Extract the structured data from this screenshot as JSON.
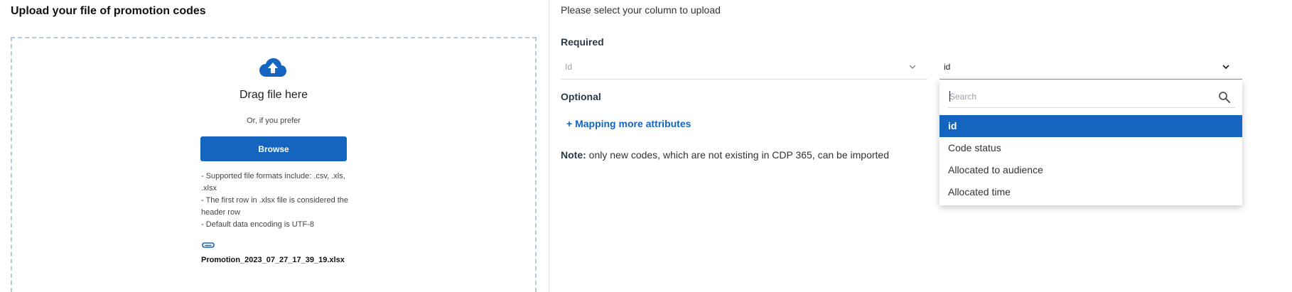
{
  "upload": {
    "title": "Upload your file of promotion codes",
    "drag_text": "Drag file here",
    "prefer_text": "Or, if you prefer",
    "browse_label": "Browse",
    "hints": [
      "- Supported file formats include: .csv, .xls, .xlsx",
      "- The first row in .xlsx file is considered the header row",
      "- Default data encoding is UTF-8"
    ],
    "file_name": "Promotion_2023_07_27_17_39_19.xlsx"
  },
  "mapping": {
    "select_title": "Please select your column to upload",
    "required_title": "Required",
    "attribute_value": "Id",
    "column_value": "id",
    "optional_title": "Optional",
    "mapping_link": "+ Mapping more attributes",
    "note_label": "Note:",
    "note_text": " only new codes, which are not existing in CDP 365, can be imported"
  },
  "dropdown": {
    "search_placeholder": "Search",
    "options": [
      "id",
      "Code status",
      "Allocated to audience",
      "Allocated time"
    ],
    "selected": "id"
  },
  "colors": {
    "accent": "#1565c0",
    "dashed_border": "#b9c9dd"
  },
  "icons": {
    "upload": "cloud-upload-icon",
    "attachment": "paperclip-icon",
    "search": "search-icon",
    "chevron": "chevron-down-icon"
  }
}
